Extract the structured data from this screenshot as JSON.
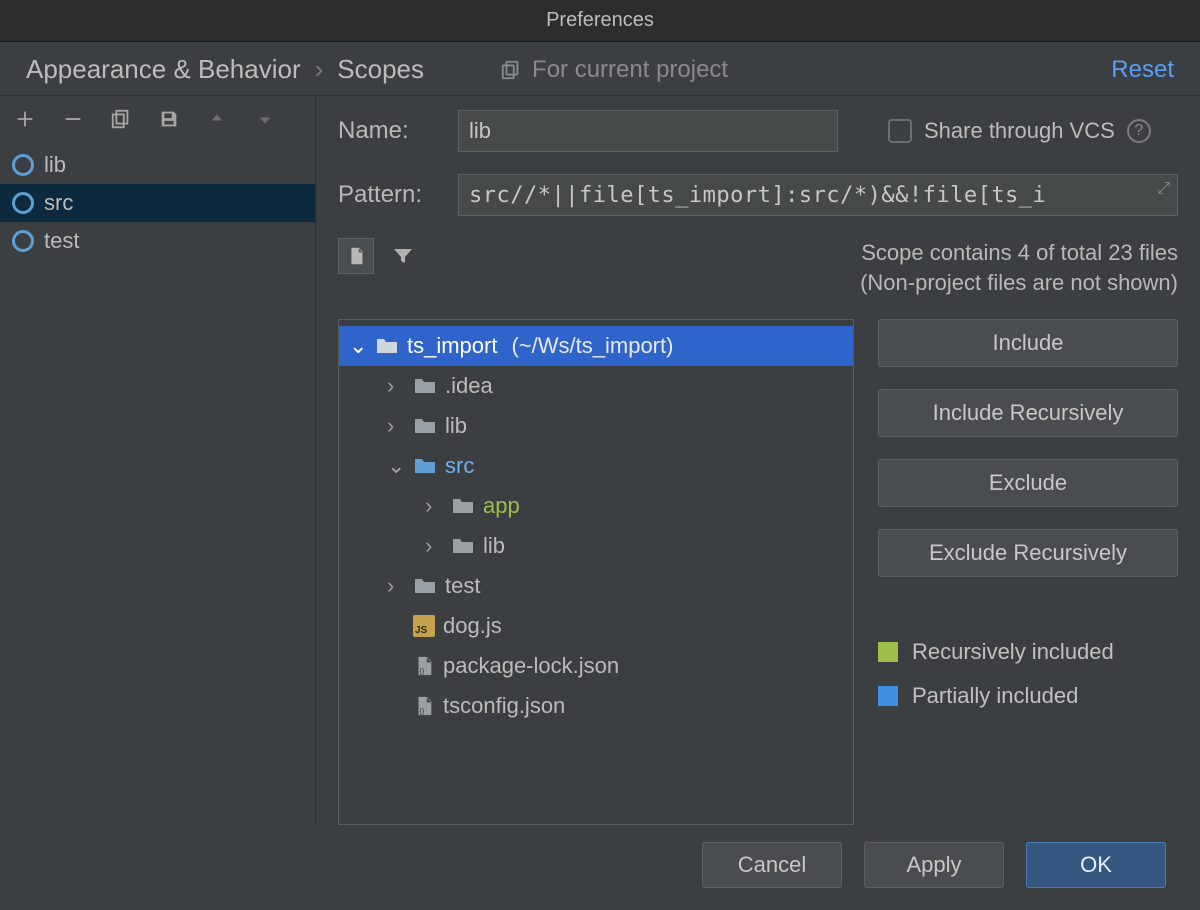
{
  "title": "Preferences",
  "breadcrumb": {
    "a": "Appearance & Behavior",
    "b": "Scopes"
  },
  "projectScopeLabel": "For current project",
  "resetLabel": "Reset",
  "scopes": {
    "items": [
      {
        "label": "lib",
        "selected": false
      },
      {
        "label": "src",
        "selected": true
      },
      {
        "label": "test",
        "selected": false
      }
    ]
  },
  "form": {
    "nameLabel": "Name:",
    "nameValue": "lib",
    "shareLabel": "Share through VCS",
    "patternLabel": "Pattern:",
    "patternValue": "src//*||file[ts_import]:src/*)&&!file[ts_i"
  },
  "stats": {
    "line1": "Scope contains 4 of total 23 files",
    "line2": "(Non-project files are not shown)"
  },
  "tree": {
    "root": "ts_import",
    "rootPath": "(~/Ws/ts_import)",
    "idea": ".idea",
    "lib": "lib",
    "src": "src",
    "app": "app",
    "srclib": "lib",
    "test": "test",
    "dog": "dog.js",
    "pkglock": "package-lock.json",
    "tsconfig": "tsconfig.json"
  },
  "buttons": {
    "include": "Include",
    "includeRec": "Include Recursively",
    "exclude": "Exclude",
    "excludeRec": "Exclude Recursively"
  },
  "legend": {
    "rec": "Recursively included",
    "part": "Partially included"
  },
  "bottom": {
    "cancel": "Cancel",
    "apply": "Apply",
    "ok": "OK"
  }
}
